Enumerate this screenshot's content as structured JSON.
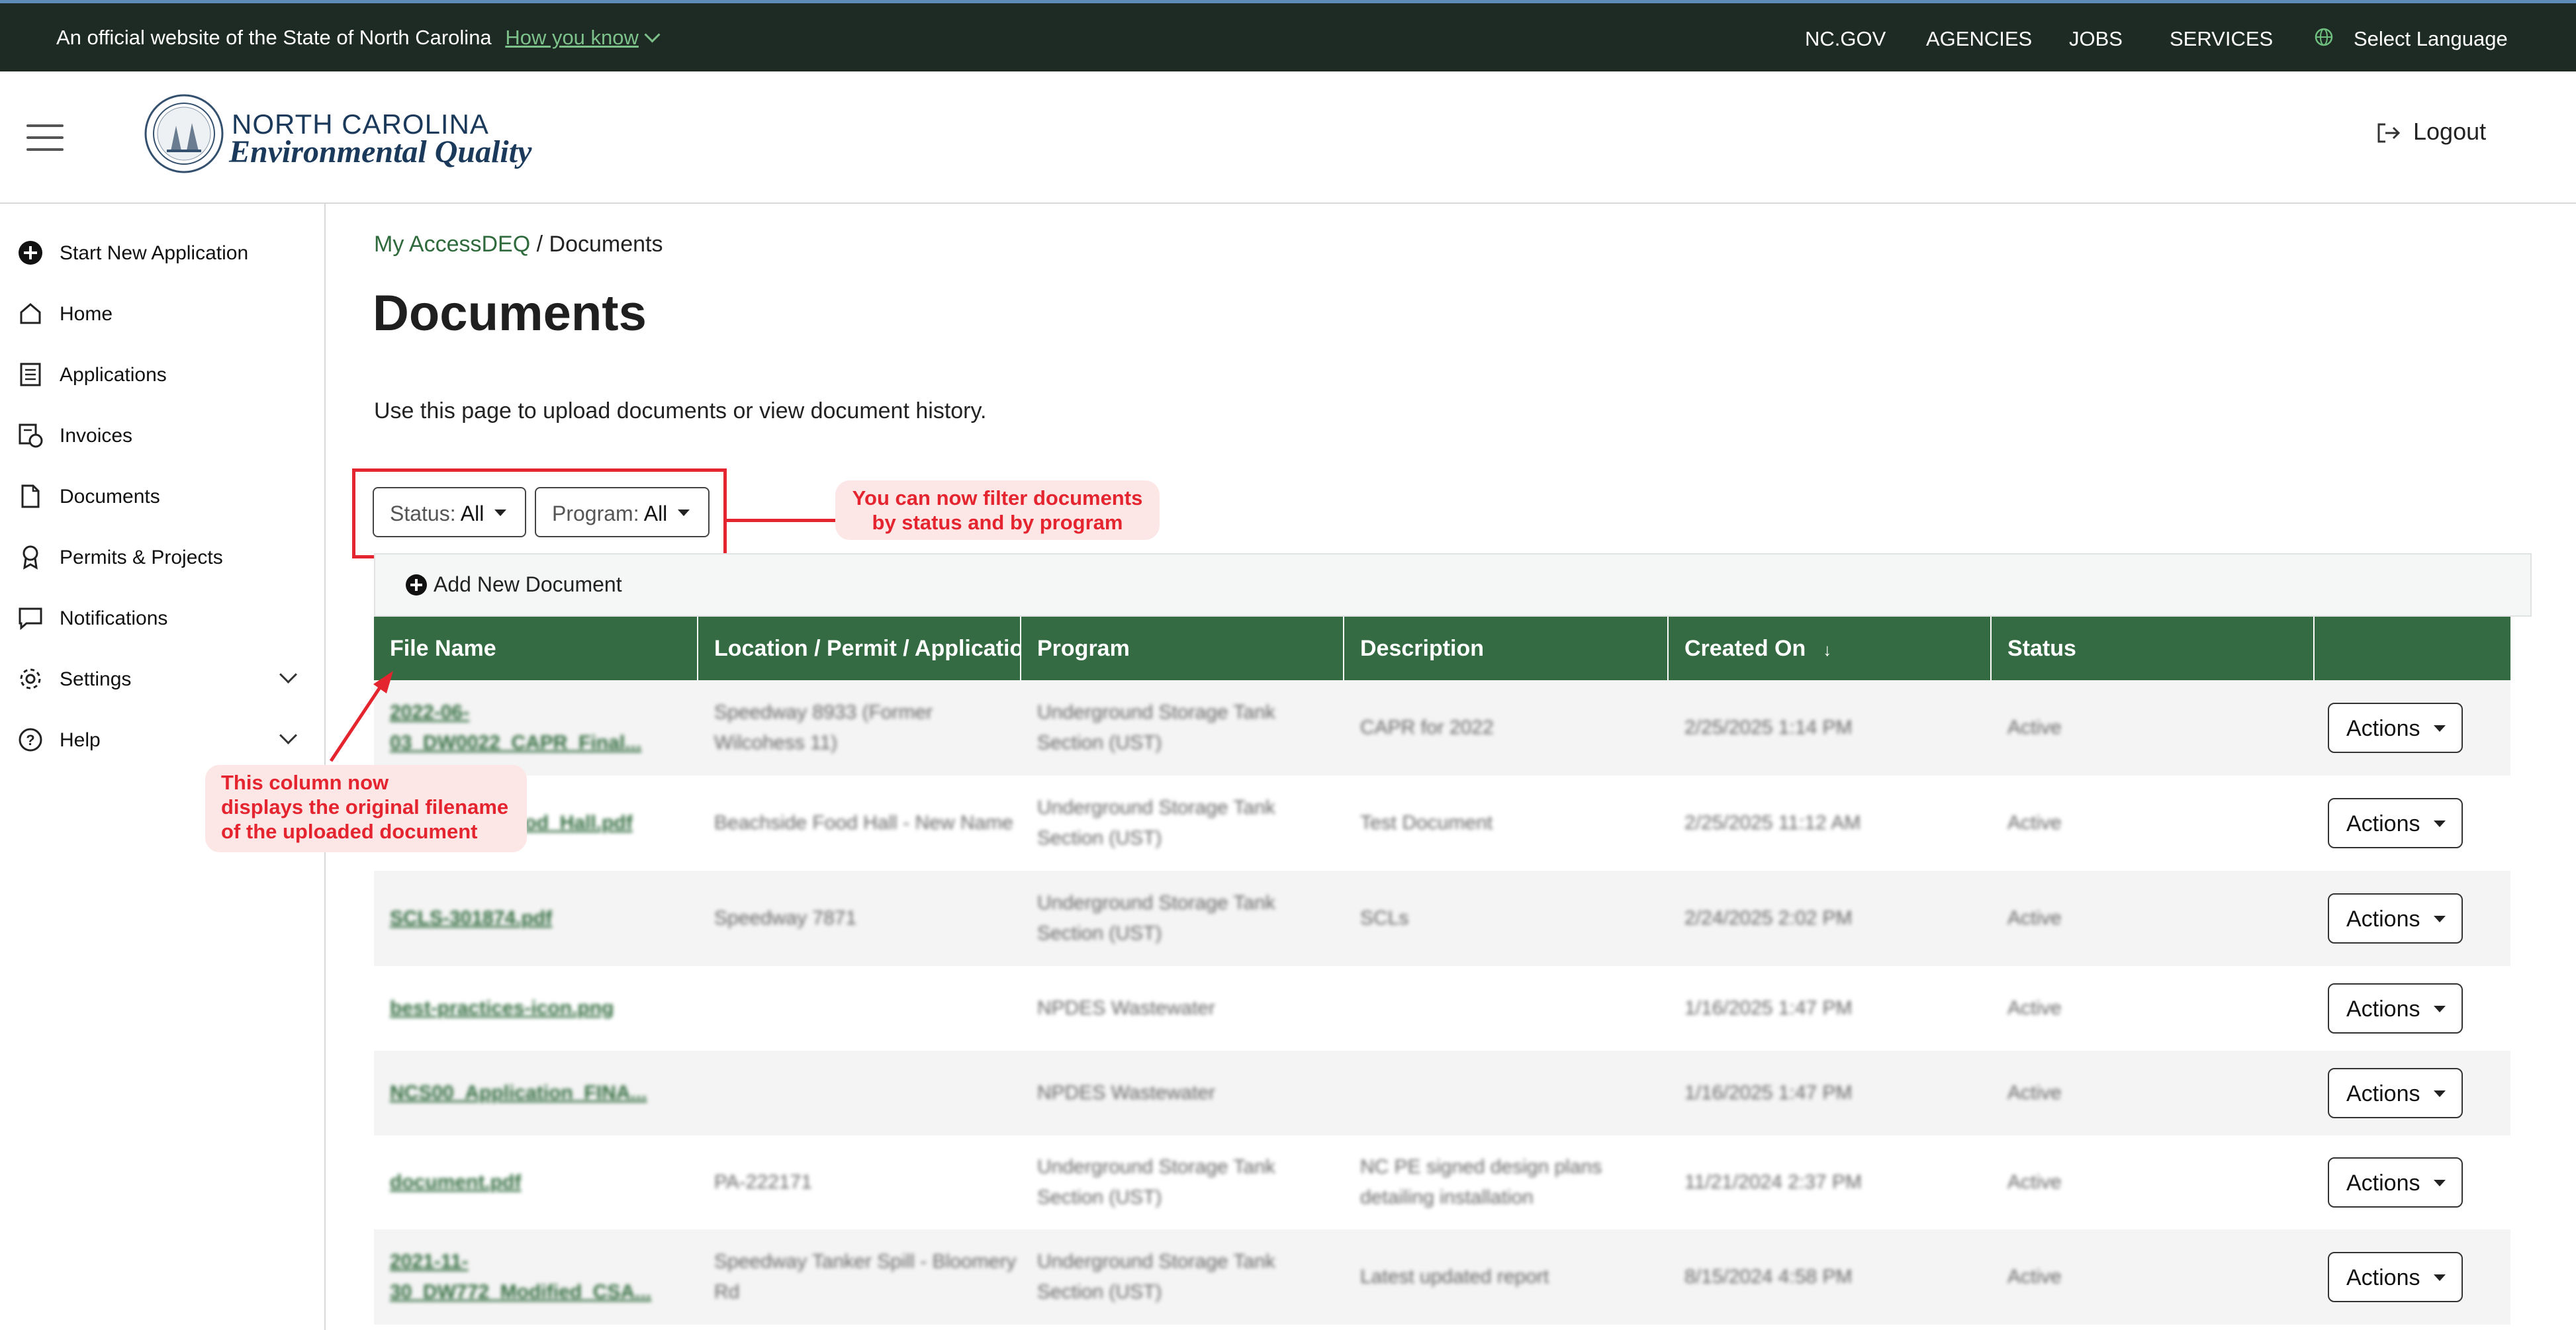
{
  "banner": {
    "official_text": "An official website of the State of North Carolina",
    "how_you_know": "How you know",
    "nav": [
      "NC.GOV",
      "AGENCIES",
      "JOBS",
      "SERVICES"
    ],
    "language": "Select Language"
  },
  "header": {
    "brand_line1": "NORTH CAROLINA",
    "brand_line2": "Environmental Quality",
    "logout": "Logout"
  },
  "sidebar": {
    "items": [
      {
        "label": "Start New Application",
        "icon": "plus-circle-icon"
      },
      {
        "label": "Home",
        "icon": "home-icon"
      },
      {
        "label": "Applications",
        "icon": "list-document-icon"
      },
      {
        "label": "Invoices",
        "icon": "invoice-icon"
      },
      {
        "label": "Documents",
        "icon": "pdf-document-icon"
      },
      {
        "label": "Permits & Projects",
        "icon": "award-icon"
      },
      {
        "label": "Notifications",
        "icon": "chat-bubble-icon"
      },
      {
        "label": "Settings",
        "icon": "gear-icon"
      },
      {
        "label": "Help",
        "icon": "question-circle-icon"
      }
    ]
  },
  "breadcrumb": {
    "link": "My AccessDEQ",
    "separator": " / ",
    "current": "Documents"
  },
  "page": {
    "title": "Documents",
    "intro": "Use this page to upload documents or view document history."
  },
  "filters": {
    "status_label": "Status:",
    "status_value": "All",
    "program_label": "Program:",
    "program_value": "All"
  },
  "annotations": {
    "filter_note_line1": "You can now filter documents",
    "filter_note_line2": "by status and by program",
    "column_note_line1": "This column now",
    "column_note_line2": "displays the original filename",
    "column_note_line3": "of the uploaded document"
  },
  "toolbar": {
    "add_document": "Add New Document"
  },
  "table": {
    "columns": [
      "File Name",
      "Location / Permit / Application",
      "Program",
      "Description",
      "Created On",
      "Status",
      ""
    ],
    "sort_indicator": "↓",
    "action_label": "Actions",
    "rows": [
      {
        "file": "2022-06-03_DW0022_CAPR_Final...",
        "location": "Speedway 8933 (Former Wilcohess 11)",
        "program": "Underground Storage Tank Section (UST)",
        "description": "CAPR for 2022",
        "created": "2/25/2025 1:14 PM",
        "status": "Active"
      },
      {
        "file": "Beachside_Food_Hall.pdf",
        "location": "Beachside Food Hall - New Name",
        "program": "Underground Storage Tank Section (UST)",
        "description": "Test Document",
        "created": "2/25/2025 11:12 AM",
        "status": "Active"
      },
      {
        "file": "SCLS-301874.pdf",
        "location": "Speedway 7871",
        "program": "Underground Storage Tank Section (UST)",
        "description": "SCLs",
        "created": "2/24/2025 2:02 PM",
        "status": "Active"
      },
      {
        "file": "best-practices-icon.png",
        "location": "",
        "program": "NPDES Wastewater",
        "description": "",
        "created": "1/16/2025 1:47 PM",
        "status": "Active"
      },
      {
        "file": "NCS00_Application_FINA...",
        "location": "",
        "program": "NPDES Wastewater",
        "description": "",
        "created": "1/16/2025 1:47 PM",
        "status": "Active"
      },
      {
        "file": "document.pdf",
        "location": "PA-222171",
        "program": "Underground Storage Tank Section (UST)",
        "description": "NC PE signed design plans detailing installation",
        "created": "11/21/2024 2:37 PM",
        "status": "Active"
      },
      {
        "file": "2021-11-30_DW772_Modified_CSA...",
        "location": "Speedway Tanker Spill - Bloomery Rd",
        "program": "Underground Storage Tank Section (UST)",
        "description": "Latest updated report",
        "created": "8/15/2024 4:58 PM",
        "status": "Active"
      }
    ]
  },
  "colors": {
    "table_header": "#346b43",
    "annotation": "#e4242e",
    "banner": "#1e2b24",
    "link": "#2f6a3c"
  }
}
